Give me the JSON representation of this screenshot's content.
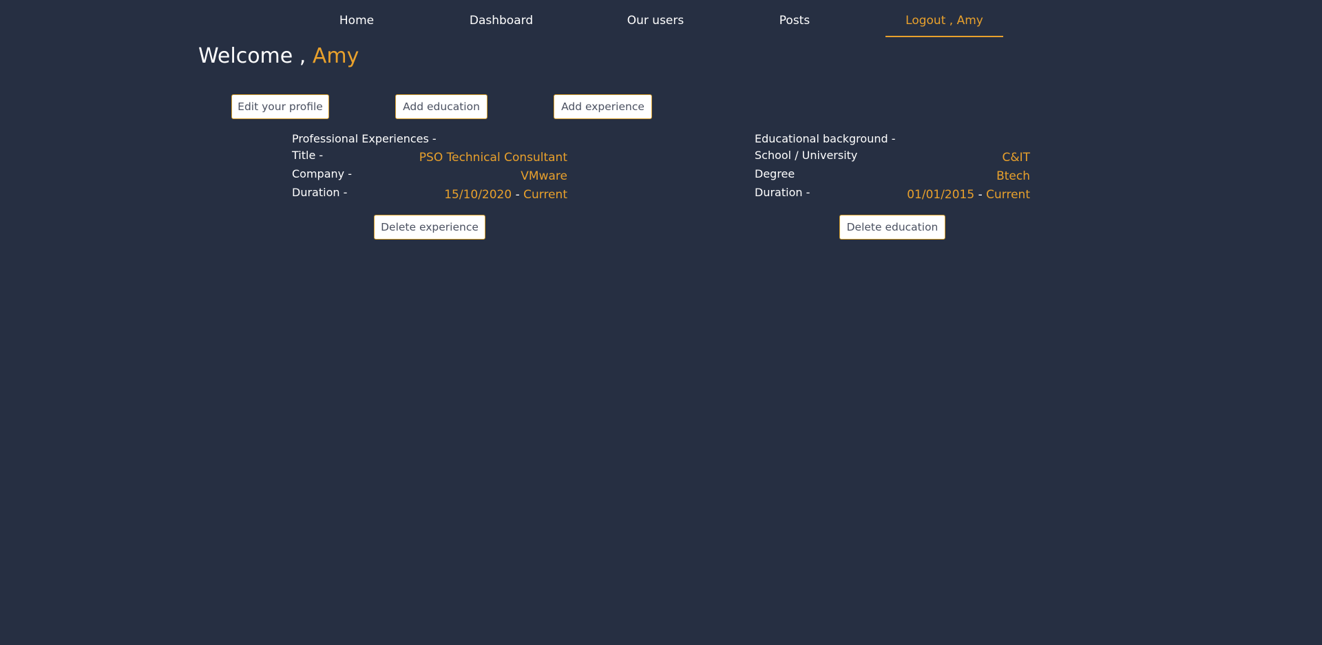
{
  "nav": {
    "items": [
      {
        "label": "Home"
      },
      {
        "label": "Dashboard"
      },
      {
        "label": "Our users"
      },
      {
        "label": "Posts"
      },
      {
        "label": "Logout , Amy"
      }
    ],
    "active_color": "#e9a12c"
  },
  "welcome": {
    "prefix": "Welcome ,",
    "name": "Amy"
  },
  "actions": {
    "edit_profile": "Edit your profile",
    "add_education": "Add education",
    "add_experience": "Add experience"
  },
  "experience": {
    "heading": "Professional Experiences -",
    "title_label": "Title -",
    "title_value": "PSO Technical Consultant",
    "company_label": "Company -",
    "company_value": "VMware",
    "duration_label": "Duration -",
    "duration_start": "15/10/2020",
    "duration_sep": "-",
    "duration_end": "Current",
    "delete_label": "Delete experience"
  },
  "education": {
    "heading": "Educational background -",
    "school_label": "School / University",
    "school_value": "C&IT",
    "degree_label": "Degree",
    "degree_value": "Btech",
    "duration_label": "Duration -",
    "duration_start": "01/01/2015",
    "duration_sep": "-",
    "duration_end": "Current",
    "delete_label": "Delete education"
  },
  "colors": {
    "background": "#262f42",
    "accent": "#e9a12c",
    "text": "#ffffff",
    "button_bg": "#ffffff",
    "button_text": "#4a5060"
  }
}
